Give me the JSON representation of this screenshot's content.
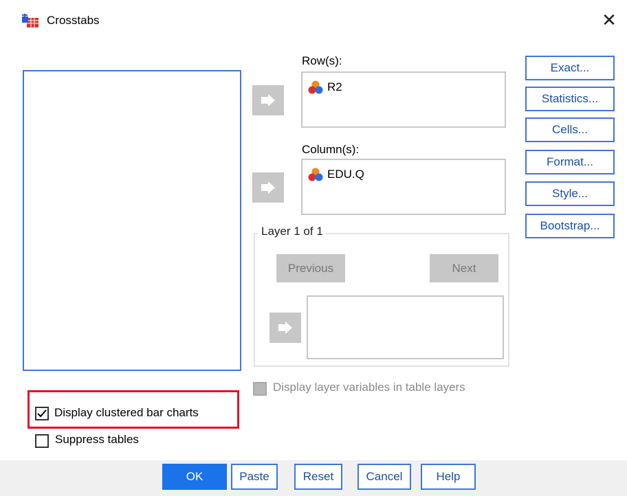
{
  "window": {
    "title": "Crosstabs",
    "close_glyph": "✕"
  },
  "source_list": {
    "items": []
  },
  "rows": {
    "label": "Row(s):",
    "items": [
      {
        "name": "R2",
        "icon": "nominal-variable-icon"
      }
    ]
  },
  "columns": {
    "label": "Column(s):",
    "items": [
      {
        "name": "EDU.Q",
        "icon": "nominal-variable-icon"
      }
    ]
  },
  "layer": {
    "title": "Layer 1 of 1",
    "previous_label": "Previous",
    "next_label": "Next",
    "items": []
  },
  "side_buttons": [
    {
      "label": "Exact..."
    },
    {
      "label": "Statistics..."
    },
    {
      "label": "Cells..."
    },
    {
      "label": "Format..."
    },
    {
      "label": "Style..."
    },
    {
      "label": "Bootstrap..."
    }
  ],
  "options": {
    "display_layer_vars": {
      "label": "Display layer variables in table layers",
      "checked": false,
      "enabled": false
    },
    "clustered_bar": {
      "label": "Display clustered bar charts",
      "checked": true
    },
    "suppress_tables": {
      "label": "Suppress tables",
      "checked": false
    }
  },
  "footer": {
    "ok": "OK",
    "paste": "Paste",
    "reset": "Reset",
    "cancel": "Cancel",
    "help": "Help"
  },
  "colors": {
    "accent": "#3f76d8",
    "ok_button": "#1a73e8",
    "highlight": "#e0142b",
    "disabled_gray": "#c7c7c7"
  }
}
